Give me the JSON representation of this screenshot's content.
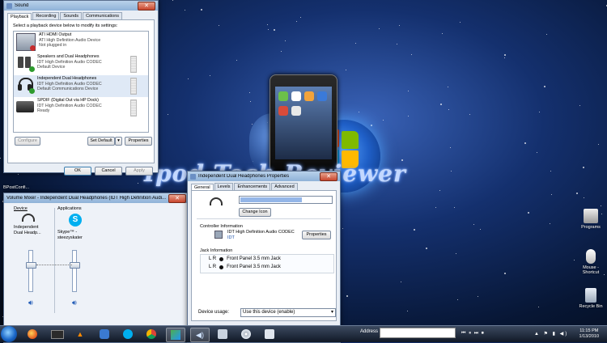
{
  "wallpaper": {
    "brand_text": "Ipod Tech Reviewer"
  },
  "sound": {
    "title": "Sound",
    "tabs": [
      "Playback",
      "Recording",
      "Sounds",
      "Communications"
    ],
    "hint": "Select a playback device below to modify its settings:",
    "devices": [
      {
        "name": "ATI HDMI Output",
        "line2": "ATI High Definition Audio Device",
        "status": "Not plugged in"
      },
      {
        "name": "Speakers and Dual Headphones",
        "line2": "IDT High Definition Audio CODEC",
        "status": "Default Device"
      },
      {
        "name": "Independent Dual Headphones",
        "line2": "IDT High Definition Audio CODEC",
        "status": "Default Communications Device"
      },
      {
        "name": "SPDIF (Digital Out via HP Dock)",
        "line2": "IDT High Definition Audio CODEC",
        "status": "Ready"
      }
    ],
    "buttons": {
      "configure": "Configure",
      "set_default": "Set Default",
      "properties": "Properties",
      "ok": "OK",
      "cancel": "Cancel",
      "apply": "Apply"
    }
  },
  "mixer": {
    "title": "Volume Mixer - Independent Dual Headphones (IDT High Definition Audi...",
    "device_header": "Device",
    "apps_header": "Applications",
    "device_label": "Independent Dual Headp...",
    "app_label": "Skype™ - steezyskater"
  },
  "properties": {
    "title": "Independent Dual Headphones Properties",
    "tabs": [
      "General",
      "Levels",
      "Enhancements",
      "Advanced"
    ],
    "name_value": "Independent Dual Headphones",
    "change_icon": "Change Icon",
    "controller_header": "Controller Information",
    "controller_name": "IDT High Definition Audio CODEC",
    "controller_vendor": "IDT",
    "properties_button": "Properties",
    "jack_header": "Jack Information",
    "jacks": [
      {
        "channels": "L R",
        "label": "Front Panel 3.5 mm Jack"
      },
      {
        "channels": "L R",
        "label": "Front Panel 3.5 mm Jack"
      }
    ],
    "usage_label": "Device usage:",
    "usage_value": "Use this device (enable)"
  },
  "desktop": {
    "left_fragment": "BPostConfi...",
    "icons": [
      "Programs",
      "Mouse - Shortcut",
      "Recycle Bin"
    ]
  },
  "taskbar": {
    "address_label": "Address",
    "time": "11:15 PM",
    "date": "1/13/2010"
  }
}
